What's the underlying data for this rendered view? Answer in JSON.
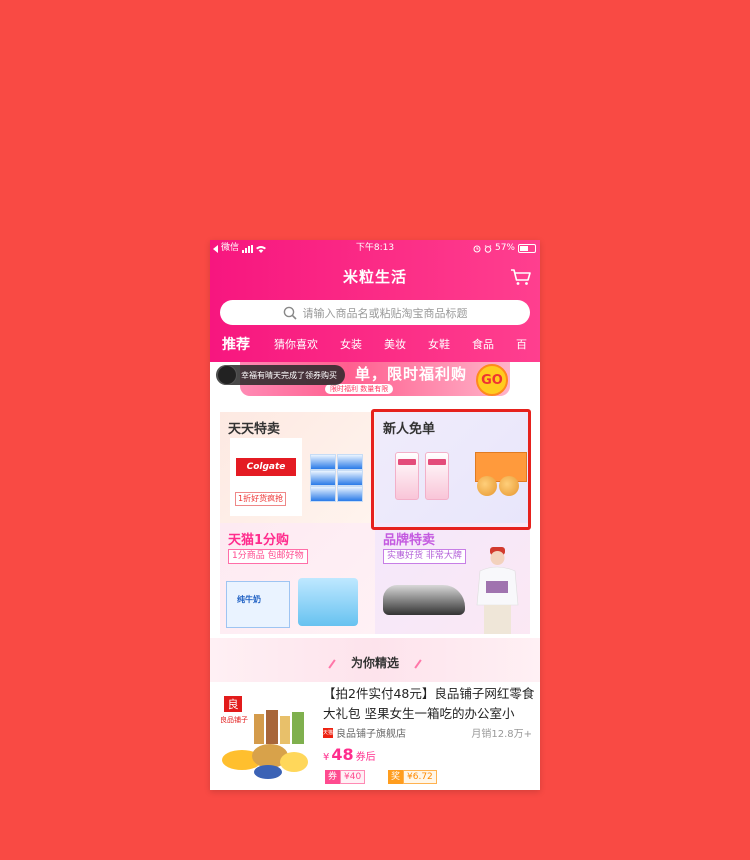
{
  "status_bar": {
    "carrier": "微信",
    "time": "下午8:13",
    "battery": "57%"
  },
  "header": {
    "title": "米粒生活",
    "search_placeholder": "请输入商品名或粘贴淘宝商品标题"
  },
  "tabs": [
    "推荐",
    "猜你喜欢",
    "女装",
    "美妆",
    "女鞋",
    "食品",
    "百"
  ],
  "banner": {
    "main_text": "单，限时福利购",
    "sub_text": "限时福利 数量有限",
    "go_label": "GO",
    "toast_text": "幸福有晴天完成了领券购买"
  },
  "grid": {
    "cell1": {
      "title": "天天特卖",
      "brand": "Colgate",
      "tag": "1折好货疯抢"
    },
    "cell2": {
      "title": "新人免单"
    },
    "cell3": {
      "title": "天猫1分购",
      "tag": "1分商品 包邮好物",
      "milk_label": "纯牛奶"
    },
    "cell4": {
      "title": "品牌特卖",
      "tag": "实惠好货 非常大牌"
    }
  },
  "section": {
    "title": "为你精选"
  },
  "product": {
    "name": "【拍2件实付48元】良品铺子网红零食大礼包 坚果女生一箱吃的办公室小",
    "shop": "良品铺子旗舰店",
    "sales": "月销12.8万+",
    "price_symbol": "¥",
    "price": "48",
    "price_suffix": "券后",
    "coupon_label": "券",
    "coupon_value": "¥40",
    "reward_label": "奖",
    "reward_value": "¥6.72",
    "brand_logo_text": "良品铺子"
  },
  "colors": {
    "page_bg": "#f94a44",
    "header_pink": "#f7167f",
    "highlight_red": "#e6211d",
    "accent_pink": "#ff2d8d"
  },
  "icons": [
    "back-icon",
    "signal-icon",
    "wifi-icon",
    "alarm-icon",
    "battery-icon",
    "cart-icon",
    "search-icon"
  ]
}
